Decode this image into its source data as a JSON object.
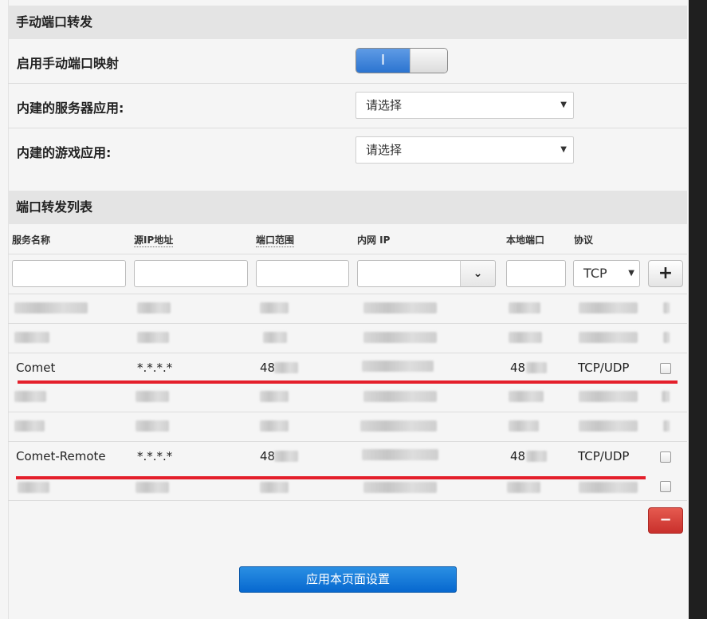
{
  "manual_section": {
    "title": "手动端口转发",
    "enable_label": "启用手动端口映射",
    "toggle_on_glyph": "I",
    "server_app_label": "内建的服务器应用:",
    "server_app_value": "请选择",
    "game_app_label": "内建的游戏应用:",
    "game_app_value": "请选择"
  },
  "list_section": {
    "title": "端口转发列表",
    "columns": [
      "服务名称",
      "源IP地址",
      "端口范围",
      "内网 IP",
      "本地端口",
      "协议"
    ],
    "new_entry": {
      "protocol": "TCP",
      "add_glyph": "+",
      "dropdown_glyph": "⌄"
    },
    "rows": [
      {
        "service": "",
        "source_ip": "",
        "port": "",
        "lan_ip": "",
        "local_port": "",
        "protocol": ""
      },
      {
        "service": "",
        "source_ip": "",
        "port": "",
        "lan_ip": "",
        "local_port": "",
        "protocol": ""
      },
      {
        "service": "Comet",
        "source_ip": "*.*.*.*",
        "port": "48",
        "lan_ip": "",
        "local_port": "48",
        "protocol": "TCP/UDP"
      },
      {
        "service": "",
        "source_ip": "",
        "port": "",
        "lan_ip": "",
        "local_port": "",
        "protocol": ""
      },
      {
        "service": "",
        "source_ip": "",
        "port": "",
        "lan_ip": "",
        "local_port": "",
        "protocol": ""
      },
      {
        "service": "Comet-Remote",
        "source_ip": "*.*.*.*",
        "port": "48",
        "lan_ip": "",
        "local_port": "48",
        "protocol": "TCP/UDP"
      },
      {
        "service": "",
        "source_ip": "",
        "port": "",
        "lan_ip": "",
        "local_port": "",
        "protocol": ""
      }
    ],
    "delete_glyph": "−",
    "apply_label": "应用本页面设置"
  },
  "colors": {
    "accent": "#2b74d0",
    "danger": "#c9302c",
    "highlight_line": "#e41f2b"
  }
}
